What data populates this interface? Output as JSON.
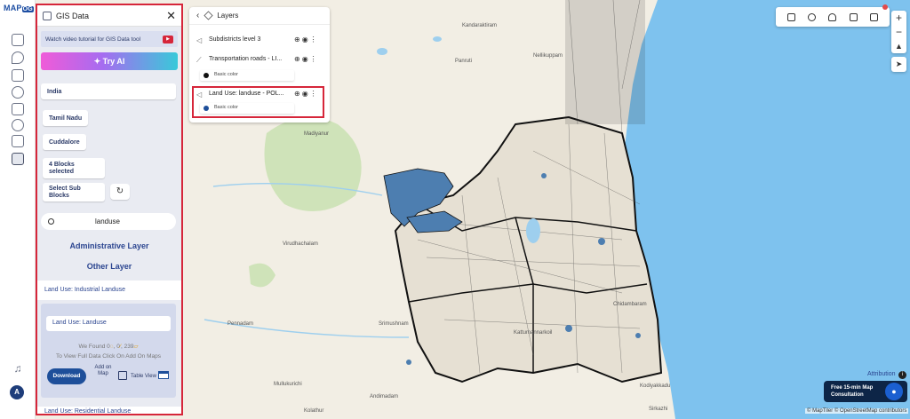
{
  "app": {
    "logo_text": "MAP",
    "logo_suffix": "OG"
  },
  "gis_panel": {
    "title": "GIS Data",
    "tutorial_text": "Watch video tutorial for GIS Data tool",
    "try_ai_label": "✦ Try AI",
    "selections": {
      "country": "India",
      "state": "Tamil Nadu",
      "district": "Cuddalore",
      "blocks": "4 Blocks selected",
      "sub_blocks": "Select Sub Blocks"
    },
    "search": {
      "value": "landuse",
      "placeholder": "Search"
    },
    "admin_layer_label": "Administrative Layer",
    "other_layer_label": "Other Layer",
    "industrial_item": "Land Use: Industrial Landuse",
    "landuse_card": {
      "title": "Land Use: Landuse",
      "found_prefix": "We Found",
      "found_points": "0",
      "found_lines": "0",
      "found_polygons": "239",
      "view_full": "To View Full Data Click On Add On Maps",
      "download_label": "Download",
      "add_on_map_label": "Add on Map",
      "table_view_label": "Table View"
    },
    "residential_item": "Land Use: Residential Landuse"
  },
  "layers_panel": {
    "title": "Layers",
    "layers": [
      {
        "name": "Subdistricts level 3"
      },
      {
        "name": "Transportation  roads - LI...",
        "swatch_label": "Basic color",
        "swatch_color": "#111111"
      },
      {
        "name": "Land Use: landuse - POL...",
        "swatch_label": "Basic color",
        "swatch_color": "#1e4f9a"
      }
    ]
  },
  "map": {
    "labels": [
      "Kandaraktiram",
      "Panruti",
      "Nellikuppam",
      "Madiyanur",
      "Virudhachalam",
      "Pennadam",
      "Srimushnam",
      "Mullukurichi",
      "Andimadam",
      "Kolathur",
      "Kattumannarkoil",
      "Kodiyakkadu",
      "Chidambaram",
      "Sirkazhi",
      "Attribution"
    ],
    "credit": "© MapTiler © OpenStreetMap contributors"
  },
  "consult": {
    "text": "Free 15-min Map Consultation"
  },
  "attribution": "Attribution",
  "user_initial": "A",
  "colors": {
    "accent": "#1e4f9a",
    "highlight_border": "#d6263a",
    "sea": "#7ec2ee"
  }
}
